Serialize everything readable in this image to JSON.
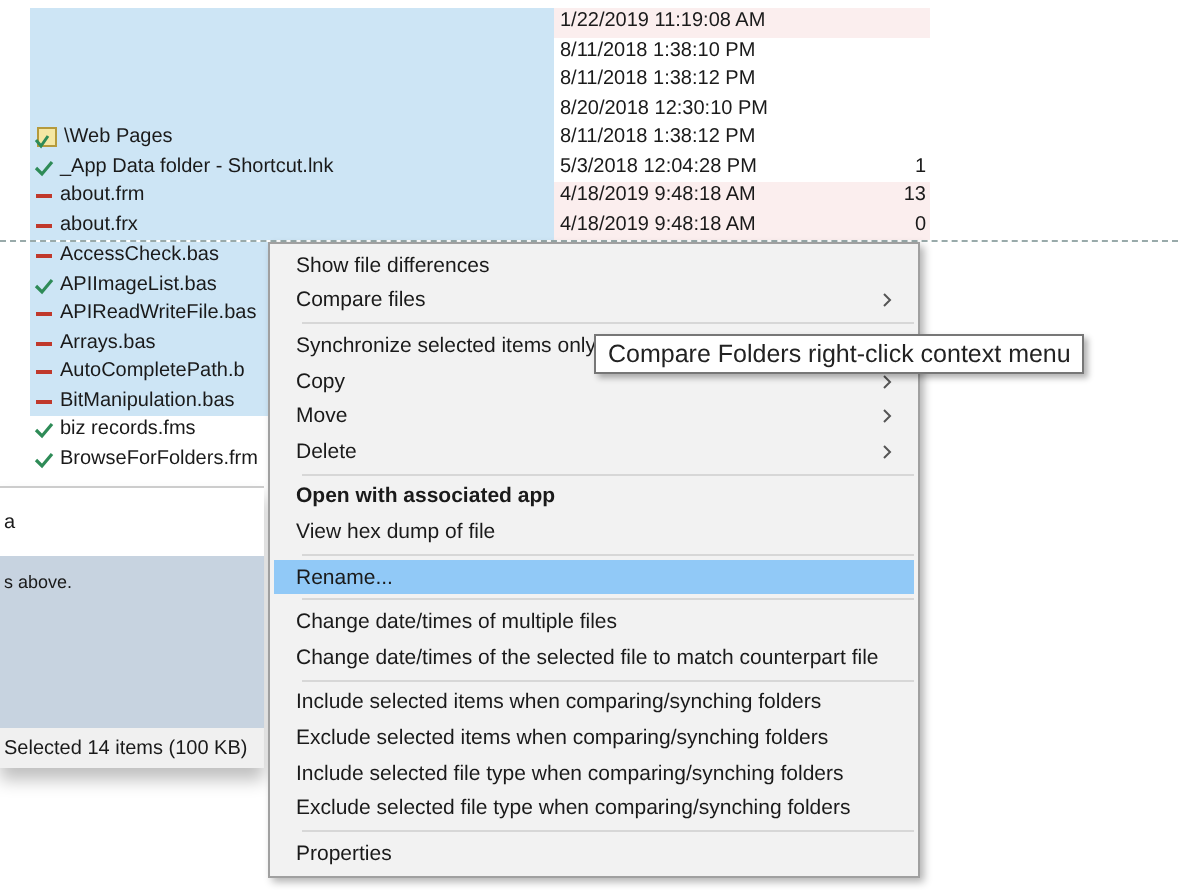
{
  "file_list": {
    "rows": [
      {
        "name": "",
        "kind": "blank",
        "date": "1/22/2019 11:19:08 AM",
        "count": "",
        "selected": true,
        "date_highlighted": true
      },
      {
        "name": "",
        "kind": "blank",
        "date": "8/11/2018 1:38:10 PM",
        "count": "",
        "selected": true,
        "date_highlighted": false
      },
      {
        "name": "",
        "kind": "blank",
        "date": "8/11/2018 1:38:12 PM",
        "count": "",
        "selected": true,
        "date_highlighted": false
      },
      {
        "name": "",
        "kind": "blank",
        "date": "8/20/2018 12:30:10 PM",
        "count": "",
        "selected": true,
        "date_highlighted": false
      },
      {
        "name": "\\Web Pages",
        "kind": "folder",
        "date": "8/11/2018 1:38:12 PM",
        "count": "",
        "selected": true,
        "date_highlighted": false
      },
      {
        "name": "_App Data folder - Shortcut.lnk",
        "kind": "same",
        "date": "5/3/2018 12:04:28 PM",
        "count": "1",
        "selected": true,
        "date_highlighted": false
      },
      {
        "name": "about.frm",
        "kind": "different",
        "date": "4/18/2019 9:48:18 AM",
        "count": "13",
        "selected": true,
        "date_highlighted": true
      },
      {
        "name": "about.frx",
        "kind": "different",
        "date": "4/18/2019 9:48:18 AM",
        "count": "0",
        "selected": true,
        "date_highlighted": true
      },
      {
        "name": "AccessCheck.bas",
        "kind": "different",
        "date": "",
        "count": "",
        "selected": true,
        "date_highlighted": false
      },
      {
        "name": "APIImageList.bas",
        "kind": "same",
        "date": "",
        "count": "",
        "selected": true,
        "date_highlighted": false
      },
      {
        "name": "APIReadWriteFile.bas",
        "kind": "different",
        "date": "",
        "count": "",
        "selected": true,
        "date_highlighted": false
      },
      {
        "name": "Arrays.bas",
        "kind": "different",
        "date": "",
        "count": "",
        "selected": true,
        "date_highlighted": false
      },
      {
        "name": "AutoCompletePath.b",
        "kind": "different",
        "date": "",
        "count": "",
        "selected": true,
        "date_highlighted": false
      },
      {
        "name": "BitManipulation.bas",
        "kind": "different",
        "date": "",
        "count": "",
        "selected": true,
        "date_highlighted": false
      },
      {
        "name": "biz records.fms",
        "kind": "same",
        "date": "",
        "count": "",
        "selected": false,
        "date_highlighted": false
      },
      {
        "name": "BrowseForFolders.frm",
        "kind": "same",
        "date": "",
        "count": "",
        "selected": false,
        "date_highlighted": false
      }
    ]
  },
  "lower_panel": {
    "heading": "a",
    "note": "s above.",
    "status_bar": "Selected 14 items (100 KB)"
  },
  "context_menu": [
    {
      "kind": "item",
      "label": "Show file differences",
      "bold": false,
      "submenu": false,
      "selected": false
    },
    {
      "kind": "item",
      "label": "Compare files",
      "bold": false,
      "submenu": true,
      "selected": false
    },
    {
      "kind": "separator"
    },
    {
      "kind": "item",
      "label": "Synchronize selected items only",
      "bold": false,
      "selected": false
    },
    {
      "kind": "item",
      "label": "Copy",
      "bold": false,
      "submenu": true,
      "selected": false
    },
    {
      "kind": "item",
      "label": "Move",
      "bold": false,
      "submenu": true,
      "selected": false
    },
    {
      "kind": "item",
      "label": "Delete",
      "bold": false,
      "submenu": true,
      "selected": false
    },
    {
      "kind": "separator"
    },
    {
      "kind": "item",
      "label": "Open with associated app",
      "bold": true,
      "submenu": false,
      "selected": false
    },
    {
      "kind": "item",
      "label": "View hex dump of file",
      "bold": false,
      "submenu": false,
      "selected": false
    },
    {
      "kind": "separator"
    },
    {
      "kind": "item",
      "label": "Rename...",
      "bold": false,
      "submenu": false,
      "selected": true
    },
    {
      "kind": "separator"
    },
    {
      "kind": "item",
      "label": "Change date/times of multiple files",
      "bold": false,
      "submenu": false,
      "selected": false
    },
    {
      "kind": "item",
      "label": "Change date/times of the selected file to match counterpart file",
      "bold": false,
      "submenu": false,
      "selected": false
    },
    {
      "kind": "separator"
    },
    {
      "kind": "item",
      "label": "Include selected items when comparing/synching folders",
      "bold": false,
      "submenu": false,
      "selected": false
    },
    {
      "kind": "item",
      "label": "Exclude selected items when comparing/synching folders",
      "bold": false,
      "submenu": false,
      "selected": false
    },
    {
      "kind": "item",
      "label": "Include selected file type when comparing/synching folders",
      "bold": false,
      "submenu": false,
      "selected": false
    },
    {
      "kind": "item",
      "label": "Exclude selected file type when comparing/synching folders",
      "bold": false,
      "submenu": false,
      "selected": false
    },
    {
      "kind": "separator"
    },
    {
      "kind": "item",
      "label": "Properties",
      "bold": false,
      "submenu": false,
      "selected": false
    }
  ],
  "callout": {
    "text": "Compare Folders right-click context menu"
  }
}
